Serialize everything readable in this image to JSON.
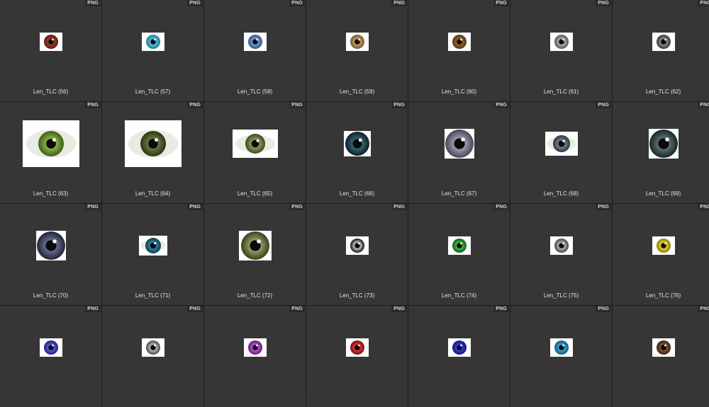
{
  "tiles": [
    {
      "name": "Len_TLC (56)",
      "badge": "PNG",
      "thumb": "square",
      "iris": "#a5402d",
      "iris_edge": "#5a1a10"
    },
    {
      "name": "Len_TLC (57)",
      "badge": "PNG",
      "thumb": "square",
      "iris": "#5cc6dc",
      "iris_edge": "#1f7f96"
    },
    {
      "name": "Len_TLC (58)",
      "badge": "PNG",
      "thumb": "square",
      "iris": "#7aa2d8",
      "iris_edge": "#2e5690"
    },
    {
      "name": "Len_TLC (59)",
      "badge": "PNG",
      "thumb": "square",
      "iris": "#c4a06a",
      "iris_edge": "#7a5a2a"
    },
    {
      "name": "Len_TLC (60)",
      "badge": "PNG",
      "thumb": "square",
      "iris": "#9b6a30",
      "iris_edge": "#55360f"
    },
    {
      "name": "Len_TLC (61)",
      "badge": "PNG",
      "thumb": "square",
      "iris": "#b8b8b8",
      "iris_edge": "#555555"
    },
    {
      "name": "Len_TLC (62)",
      "badge": "PNG",
      "thumb": "square",
      "iris": "#8f8f8f",
      "iris_edge": "#3a3a3a"
    },
    {
      "name": "Len_TLC (63)",
      "badge": "PNG",
      "thumb": "photo-large",
      "iris": "#8fb846",
      "iris_edge": "#3f5e1c"
    },
    {
      "name": "Len_TLC (64)",
      "badge": "PNG",
      "thumb": "photo-large",
      "iris": "#6e7e40",
      "iris_edge": "#2a3418"
    },
    {
      "name": "Len_TLC (65)",
      "badge": "PNG",
      "thumb": "photo-wide",
      "iris": "#8fa460",
      "iris_edge": "#3c4a22"
    },
    {
      "name": "Len_TLC (66)",
      "badge": "PNG",
      "thumb": "round-dark",
      "iris": "#3a6a7a",
      "iris_edge": "#0e1e24"
    },
    {
      "name": "Len_TLC (67)",
      "badge": "PNG",
      "thumb": "round-med",
      "iris": "#a8a0b4",
      "iris_edge": "#4a4456"
    },
    {
      "name": "Len_TLC (68)",
      "badge": "PNG",
      "thumb": "photo-small",
      "iris": "#7c8896",
      "iris_edge": "#2c3440"
    },
    {
      "name": "Len_TLC (69)",
      "badge": "PNG",
      "thumb": "round-med",
      "iris": "#5e7478",
      "iris_edge": "#1a2628"
    },
    {
      "name": "Len_TLC (70)",
      "badge": "PNG",
      "thumb": "round-med",
      "iris": "#6a7090",
      "iris_edge": "#202438"
    },
    {
      "name": "Len_TLC (71)",
      "badge": "PNG",
      "thumb": "wide-small",
      "iris": "#2f8aa6",
      "iris_edge": "#0c3a4a"
    },
    {
      "name": "Len_TLC (72)",
      "badge": "PNG",
      "thumb": "round-big",
      "iris": "#9aa26a",
      "iris_edge": "#3a3f1a"
    },
    {
      "name": "Len_TLC (73)",
      "badge": "PNG",
      "thumb": "square",
      "iris": "#d8d8d8",
      "iris_edge": "#111111"
    },
    {
      "name": "Len_TLC (74)",
      "badge": "PNG",
      "thumb": "square",
      "iris": "#46c046",
      "iris_edge": "#126012"
    },
    {
      "name": "Len_TLC (75)",
      "badge": "PNG",
      "thumb": "square",
      "iris": "#bdbdbd",
      "iris_edge": "#444444"
    },
    {
      "name": "Len_TLC (76)",
      "badge": "PNG",
      "thumb": "square",
      "iris": "#e6dc2a",
      "iris_edge": "#8a7e0a"
    },
    {
      "name": "",
      "badge": "PNG",
      "thumb": "square",
      "iris": "#6262e0",
      "iris_edge": "#1c1c8a"
    },
    {
      "name": "",
      "badge": "PNG",
      "thumb": "square",
      "iris": "#c4c4c4",
      "iris_edge": "#4a4a4a"
    },
    {
      "name": "",
      "badge": "PNG",
      "thumb": "square",
      "iris": "#c05ed8",
      "iris_edge": "#5e1a78"
    },
    {
      "name": "",
      "badge": "PNG",
      "thumb": "square",
      "iris": "#e03a3a",
      "iris_edge": "#7a0e0e"
    },
    {
      "name": "",
      "badge": "PNG",
      "thumb": "square",
      "iris": "#3a46d8",
      "iris_edge": "#0e1478"
    },
    {
      "name": "",
      "badge": "PNG",
      "thumb": "square",
      "iris": "#3ab0d8",
      "iris_edge": "#0e5a7a"
    },
    {
      "name": "",
      "badge": "PNG",
      "thumb": "square",
      "iris": "#8a5a3e",
      "iris_edge": "#3a2212"
    }
  ]
}
